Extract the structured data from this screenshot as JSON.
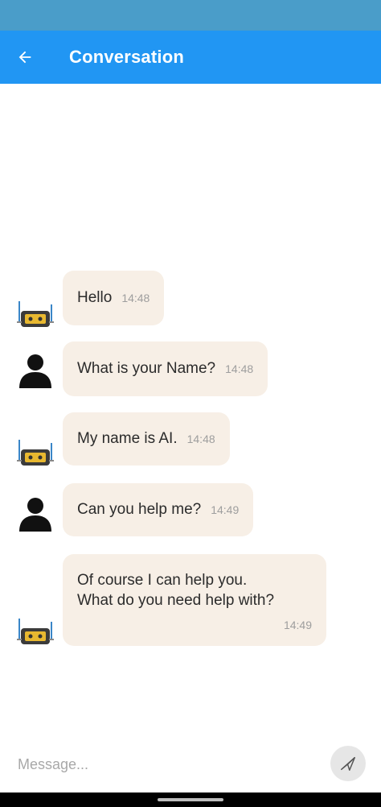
{
  "app_bar": {
    "title": "Conversation",
    "back_icon": "arrow-left-icon"
  },
  "messages": [
    {
      "sender": "bot",
      "text": "Hello",
      "time": "14:48"
    },
    {
      "sender": "user",
      "text": "What is your Name?",
      "time": "14:48"
    },
    {
      "sender": "bot",
      "text": "My name is AI.",
      "time": "14:48"
    },
    {
      "sender": "user",
      "text": "Can you help me?",
      "time": "14:49"
    },
    {
      "sender": "bot",
      "text_line1": "Of course I can help you.",
      "text_line2": "What do you need help with?",
      "time": "14:49"
    }
  ],
  "composer": {
    "placeholder": "Message...",
    "send_icon": "send-icon"
  },
  "colors": {
    "status_bar": "#4a9dc9",
    "app_bar": "#2196f3",
    "bubble": "#f7efe6",
    "timestamp": "#9e9e9e"
  }
}
